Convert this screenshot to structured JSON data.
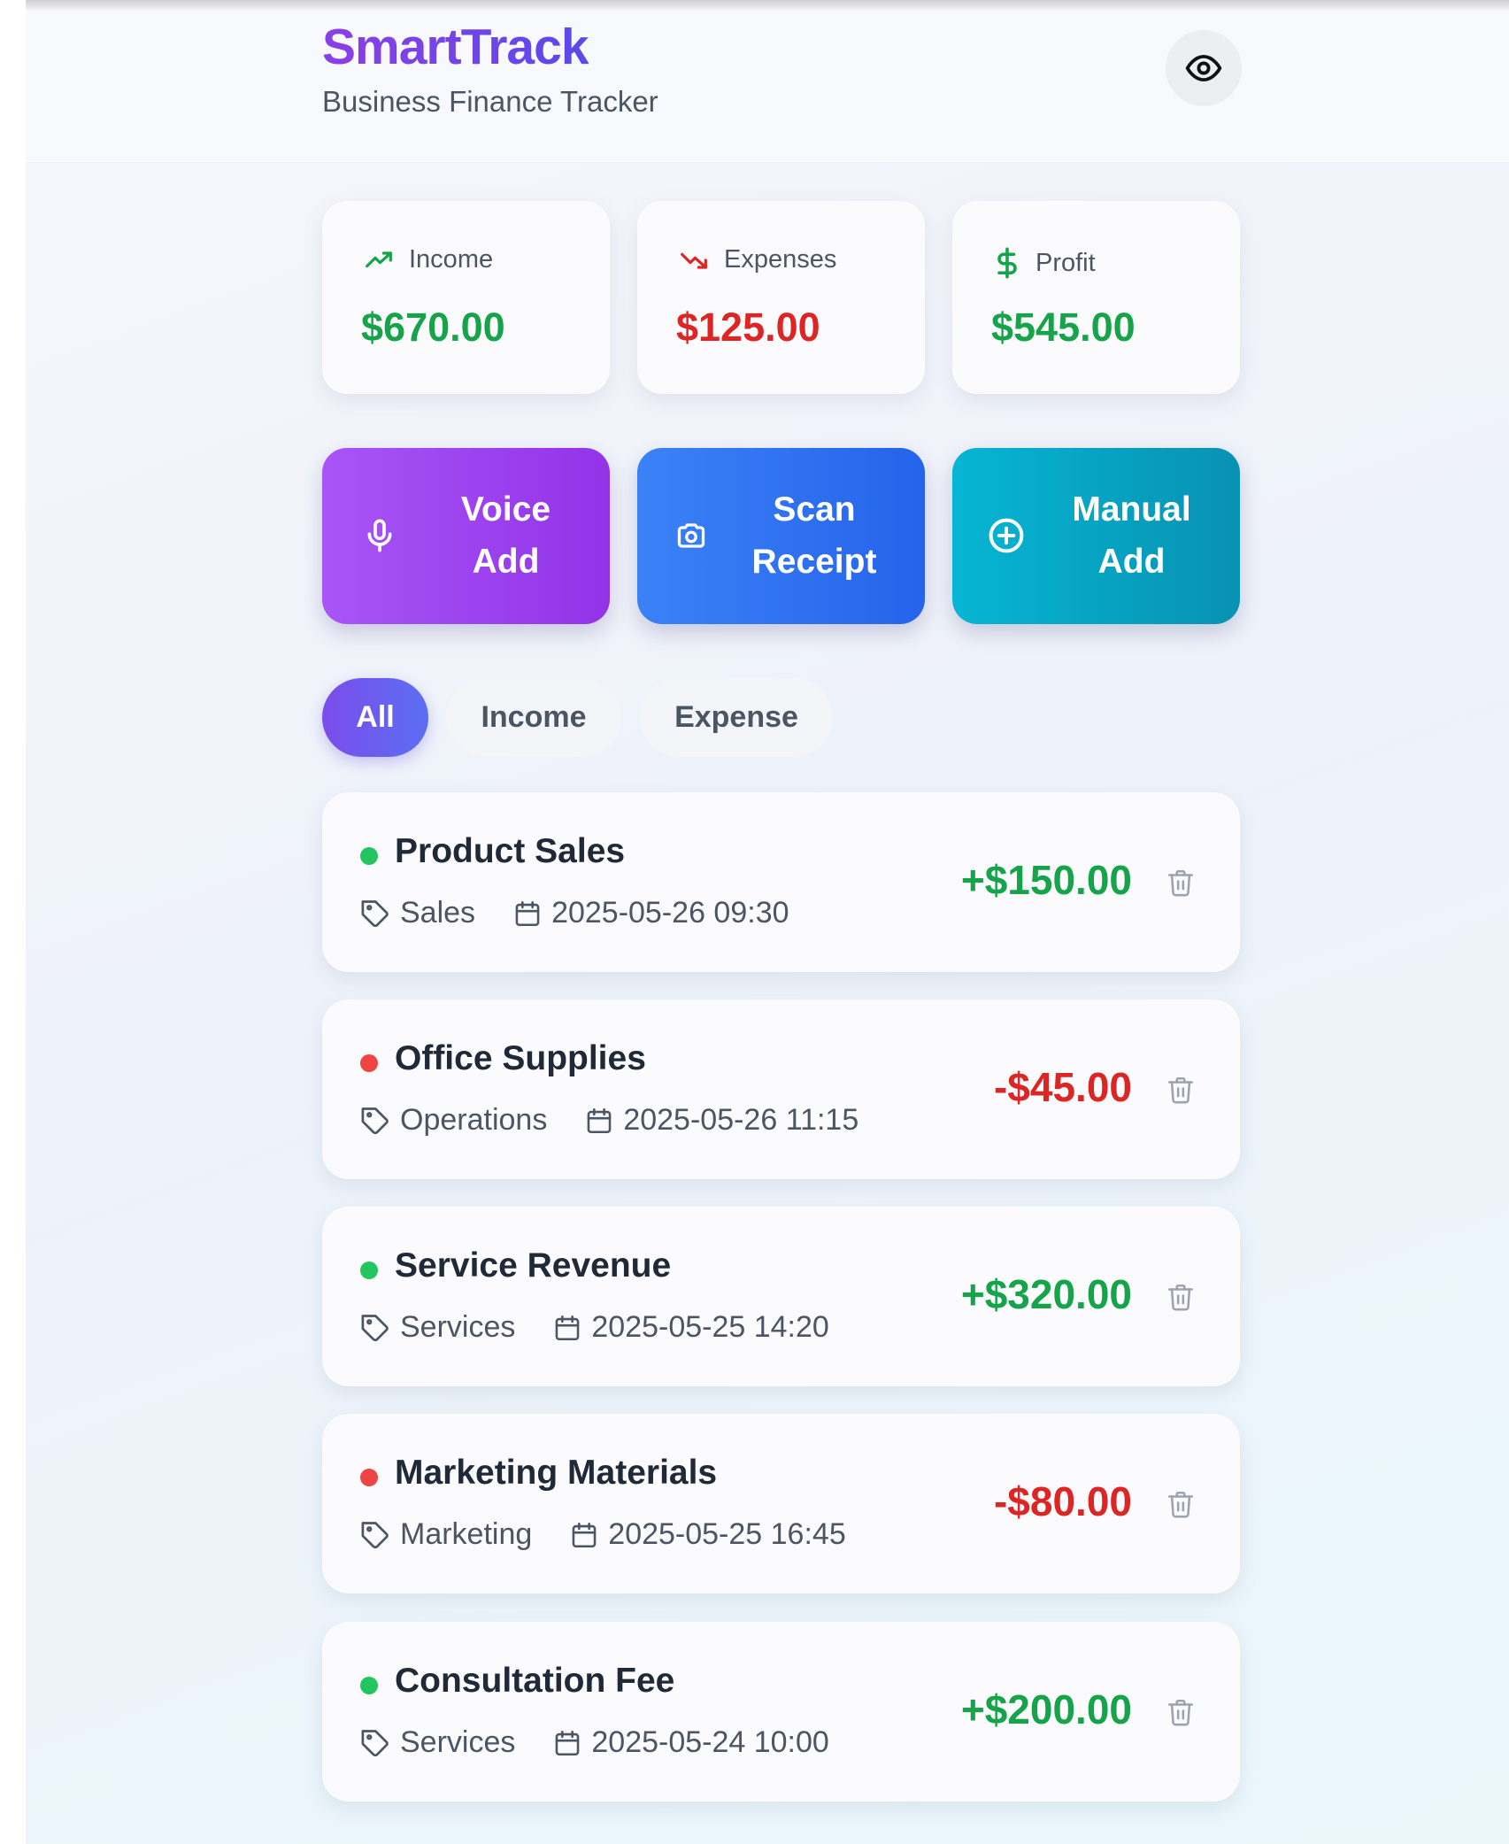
{
  "header": {
    "title": "SmartTrack",
    "subtitle": "Business Finance Tracker",
    "visibility_icon": "eye-icon"
  },
  "stats": [
    {
      "label": "Income",
      "value": "$670.00",
      "icon": "trending-up-icon",
      "color": "#16a34a"
    },
    {
      "label": "Expenses",
      "value": "$125.00",
      "icon": "trending-down-icon",
      "color": "#dc2626"
    },
    {
      "label": "Profit",
      "value": "$545.00",
      "icon": "dollar-icon",
      "color": "#16a34a"
    }
  ],
  "actions": [
    {
      "label_line1": "Voice",
      "label_line2": "Add",
      "icon": "microphone-icon"
    },
    {
      "label_line1": "Scan",
      "label_line2": "Receipt",
      "icon": "camera-icon"
    },
    {
      "label_line1": "Manual",
      "label_line2": "Add",
      "icon": "plus-circle-icon"
    }
  ],
  "filters": {
    "selected": "All",
    "items": [
      "All",
      "Income",
      "Expense"
    ]
  },
  "transactions": [
    {
      "title": "Product Sales",
      "category": "Sales",
      "datetime": "2025-05-26 09:30",
      "amount": "+$150.00",
      "type": "income"
    },
    {
      "title": "Office Supplies",
      "category": "Operations",
      "datetime": "2025-05-26 11:15",
      "amount": "-$45.00",
      "type": "expense"
    },
    {
      "title": "Service Revenue",
      "category": "Services",
      "datetime": "2025-05-25 14:20",
      "amount": "+$320.00",
      "type": "income"
    },
    {
      "title": "Marketing Materials",
      "category": "Marketing",
      "datetime": "2025-05-25 16:45",
      "amount": "-$80.00",
      "type": "expense"
    },
    {
      "title": "Consultation Fee",
      "category": "Services",
      "datetime": "2025-05-24 10:00",
      "amount": "+$200.00",
      "type": "income"
    }
  ],
  "colors": {
    "income": "#16a34a",
    "expense": "#dc2626",
    "brand": "#7c3aed"
  }
}
